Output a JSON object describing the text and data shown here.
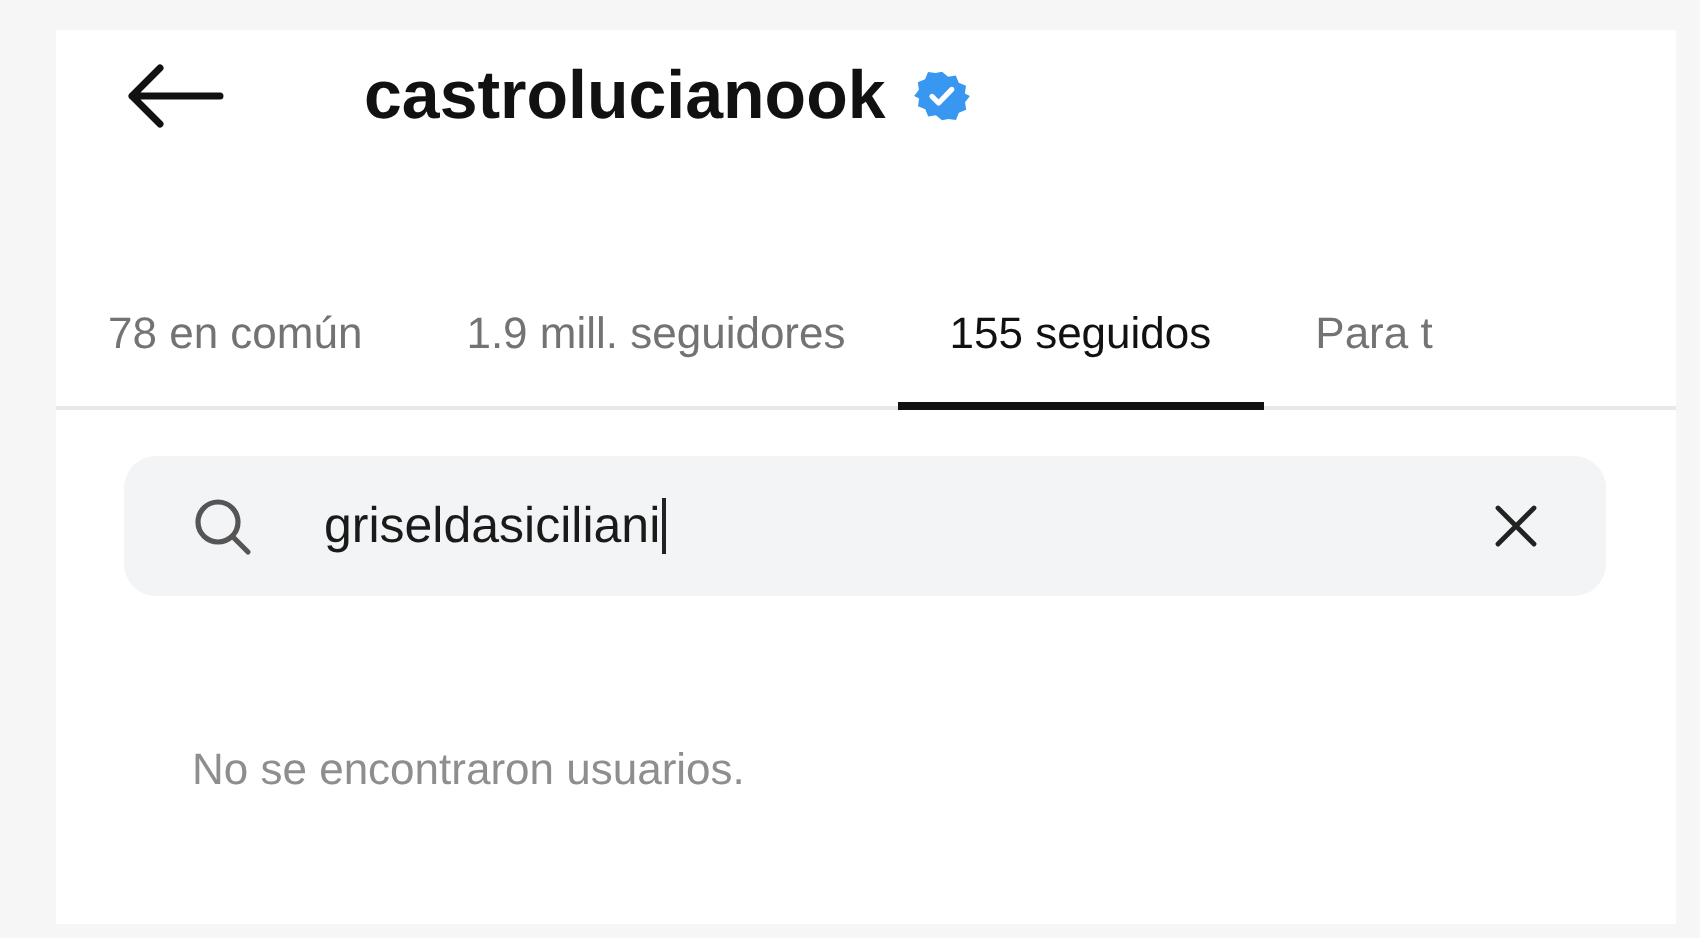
{
  "header": {
    "username": "castrolucianook",
    "verified": true
  },
  "tabs": [
    {
      "label": "78 en común",
      "selected": false
    },
    {
      "label": "1.9 mill. seguidores",
      "selected": false
    },
    {
      "label": "155 seguidos",
      "selected": true
    },
    {
      "label": "Para t",
      "selected": false
    }
  ],
  "search": {
    "value": "griseldasiciliani"
  },
  "message": "No se encontraron usuarios."
}
